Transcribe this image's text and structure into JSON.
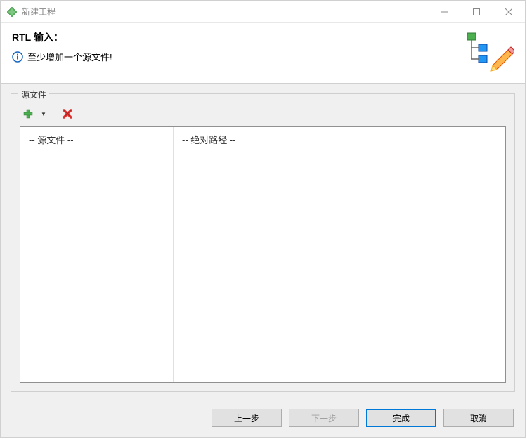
{
  "window": {
    "title": "新建工程"
  },
  "header": {
    "title": "RTL 输入：",
    "message": "至少增加一个源文件!"
  },
  "group": {
    "label": "源文件"
  },
  "table": {
    "columns": {
      "source": "--  源文件  --",
      "path": "--  绝对路经  --"
    }
  },
  "buttons": {
    "back": "上一步",
    "next": "下一步",
    "finish": "完成",
    "cancel": "取消"
  }
}
